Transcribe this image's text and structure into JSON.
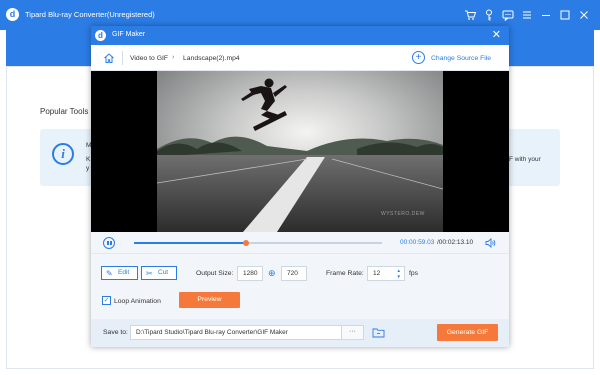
{
  "app": {
    "title": "Tipard Blu-ray Converter(Unregistered)",
    "logo_letter": "d",
    "window_controls": [
      "cart-icon",
      "key-icon",
      "chat-icon",
      "menu-icon",
      "minimize-icon",
      "maximize-icon",
      "close-icon"
    ]
  },
  "background": {
    "section_title": "Popular Tools",
    "info_icon_glyph": "i",
    "card_fragments": [
      "M",
      "K",
      "y",
      "F with your"
    ]
  },
  "dialog": {
    "title": "GIF Maker",
    "logo_letter": "d",
    "close_glyph": "✕",
    "breadcrumb": [
      "Video to GIF",
      "Landscape(2).mp4"
    ],
    "breadcrumb_separator": "›",
    "change_source_label": "Change Source File",
    "plus_glyph": "+"
  },
  "player": {
    "watermark": "WYSTERO.DEW",
    "progress": 0.45,
    "current_time": "00:00:59.03",
    "total_time": "/00:02:13.10"
  },
  "settings": {
    "edit_label": "Edit",
    "edit_glyph": "✎",
    "cut_label": "Cut",
    "cut_glyph": "✂",
    "output_size_label": "Output Size:",
    "width": "1280",
    "link_glyph": "⊕",
    "height": "720",
    "frame_rate_label": "Frame Rate:",
    "frame_rate": "12",
    "fps_label": "fps",
    "loop_label": "Loop Animation",
    "loop_checked": true,
    "check_glyph": "✓",
    "preview_label": "Preview"
  },
  "save": {
    "label": "Save to:",
    "path": "D:\\Tipard Studio\\Tipard Blu-ray Converter\\GIF Maker",
    "more_glyph": "···",
    "generate_label": "Generate GIF"
  },
  "colors": {
    "accent": "#2b7ce5",
    "orange": "#f5793b"
  }
}
